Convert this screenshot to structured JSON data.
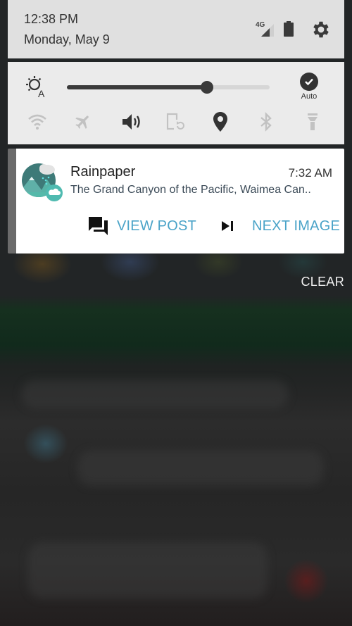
{
  "header": {
    "time": "12:38 PM",
    "date": "Monday, May 9",
    "network_label": "4G",
    "icons": [
      "signal-4g-icon",
      "battery-icon",
      "settings-gear-icon"
    ]
  },
  "quick_settings": {
    "brightness_level_percent": 69,
    "auto_label": "Auto",
    "auto_enabled": true,
    "tiles": [
      {
        "name": "wifi",
        "active": false
      },
      {
        "name": "airplane-mode",
        "active": false
      },
      {
        "name": "sound",
        "active": true
      },
      {
        "name": "auto-rotate",
        "active": false
      },
      {
        "name": "location",
        "active": true
      },
      {
        "name": "bluetooth",
        "active": false
      },
      {
        "name": "flashlight",
        "active": false
      }
    ],
    "colors": {
      "active": "#333333",
      "inactive": "#c2c2c2"
    }
  },
  "notification": {
    "app_name": "Rainpaper",
    "time": "7:32 AM",
    "text": "The Grand Canyon of the Pacific, Waimea Can..",
    "actions": [
      {
        "label": "VIEW POST",
        "icon": "forum-icon"
      },
      {
        "label": "NEXT IMAGE",
        "icon": "skip-next-icon"
      }
    ],
    "accent_color": "#4aa3c8"
  },
  "clear_label": "CLEAR"
}
